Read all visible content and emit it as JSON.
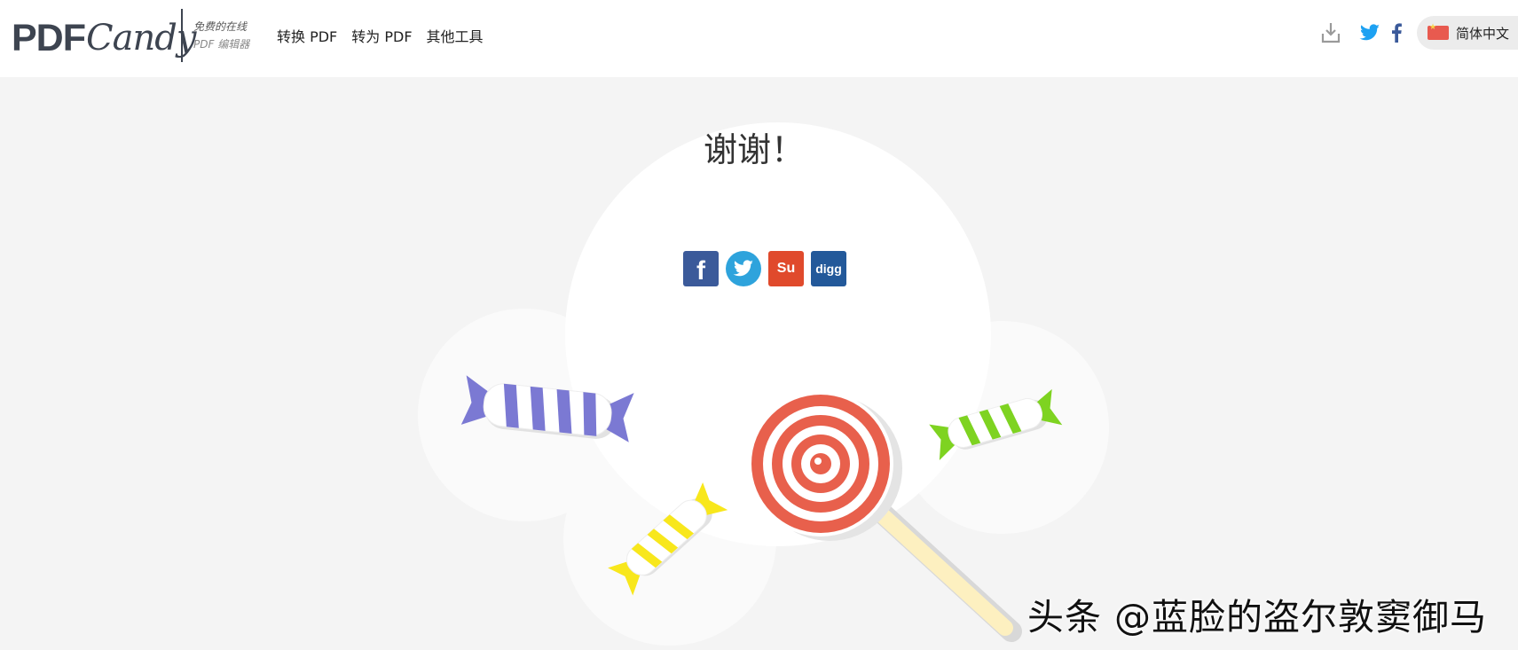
{
  "header": {
    "logo_pdf": "PDF",
    "logo_candy": "Candy",
    "tagline_line1": "免费的在线",
    "tagline_line2": "PDF 编辑器",
    "nav": [
      {
        "label": "转换 PDF"
      },
      {
        "label": "转为 PDF"
      },
      {
        "label": "其他工具"
      }
    ],
    "language": "简体中文"
  },
  "main": {
    "title": "谢谢！",
    "share": {
      "facebook_label": "f",
      "stumbleupon_label": "Su",
      "digg_label": "digg"
    }
  },
  "watermark": "头条 @蓝脸的盗尔敦窦御马",
  "colors": {
    "header_bg": "#ffffff",
    "page_bg": "#f4f4f4",
    "facebook": "#3b5a9a",
    "twitter": "#2ea3dc",
    "stumbleupon": "#e04a2c",
    "digg": "#23599a",
    "candy_purple": "#7b79d3",
    "candy_green": "#7ed321",
    "candy_yellow": "#f8e71c",
    "lollipop_red": "#e8604c"
  }
}
